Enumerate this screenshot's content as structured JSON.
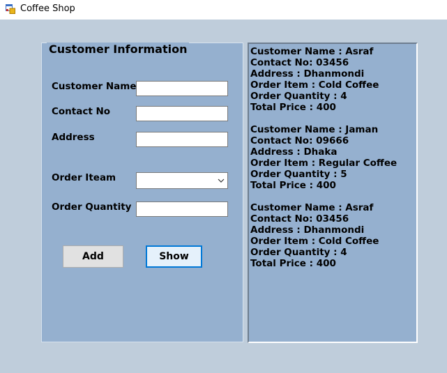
{
  "window": {
    "title": "Coffee Shop"
  },
  "form": {
    "group_title": "Customer Information",
    "labels": {
      "customer_name": "Customer Name",
      "contact_no": "Contact No",
      "address": "Address",
      "order_item": "Order Iteam",
      "order_quantity": "Order Quantity"
    },
    "inputs": {
      "customer_name": "",
      "contact_no": "",
      "address": "",
      "order_item": "",
      "order_quantity": ""
    },
    "buttons": {
      "add": "Add",
      "show": "Show"
    }
  },
  "output": {
    "records": [
      [
        "Customer Name : Asraf",
        "Contact No: 03456",
        "Address : Dhanmondi",
        "Order Item : Cold Coffee",
        "Order Quantity : 4",
        "Total Price : 400"
      ],
      [
        "Customer Name : Jaman",
        "Contact No: 09666",
        "Address : Dhaka",
        "Order Item : Regular Coffee",
        "Order Quantity : 5",
        "Total Price : 400"
      ],
      [
        "Customer Name : Asraf",
        "Contact No: 03456",
        "Address : Dhanmondi",
        "Order Item : Cold Coffee",
        "Order Quantity : 4",
        "Total Price : 400"
      ]
    ]
  },
  "icons": {
    "app": "app-window-icon",
    "dropdown": "chevron-down-icon"
  },
  "colors": {
    "background": "#bfcddb",
    "panel": "#95b0cf",
    "focus_border": "#0078d7"
  }
}
